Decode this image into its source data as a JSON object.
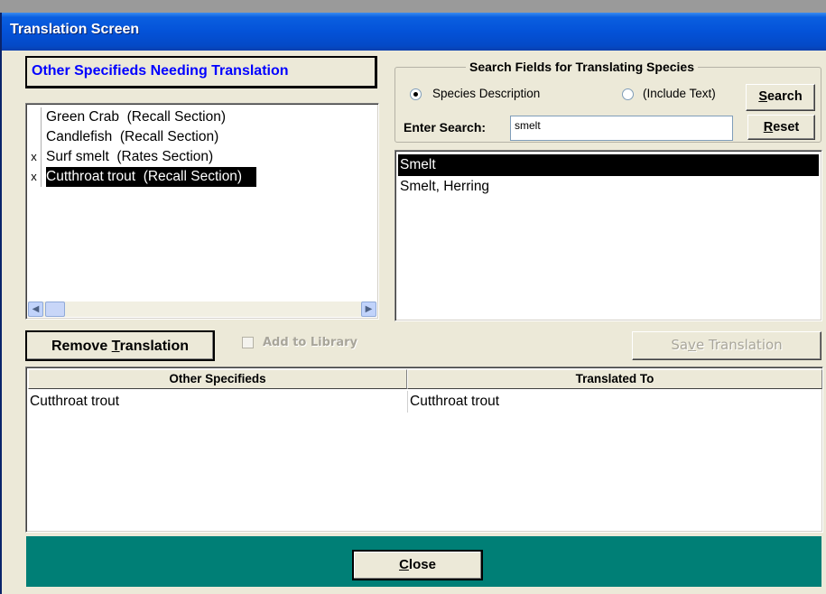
{
  "window": {
    "title": "Translation Screen",
    "titlebar_color": "#0452d8",
    "footer_color": "#007f76"
  },
  "left_panel": {
    "header": "Other Specifieds Needing Translation",
    "items": [
      {
        "mark": "",
        "label": "Green Crab  (Recall Section)",
        "selected": false
      },
      {
        "mark": "",
        "label": "Candlefish  (Recall Section)",
        "selected": false
      },
      {
        "mark": "x",
        "label": "Surf smelt  (Rates Section)",
        "selected": false
      },
      {
        "mark": "x",
        "label": "Cutthroat trout  (Recall Section)",
        "selected": true
      }
    ]
  },
  "search": {
    "group_title": "Search Fields for Translating Species",
    "radio_species": "Species Description",
    "radio_species_checked": true,
    "radio_include": "(Include Text)",
    "radio_include_checked": false,
    "enter_label": "Enter Search:",
    "value": "smelt",
    "search_button_prefix": "",
    "search_button_u": "S",
    "search_button_rest": "earch",
    "reset_button_u": "R",
    "reset_button_rest": "eset"
  },
  "results": {
    "items": [
      {
        "label": "Smelt",
        "selected": true
      },
      {
        "label": "Smelt, Herring",
        "selected": false
      }
    ]
  },
  "actions": {
    "remove_prefix": "Remove ",
    "remove_u": "T",
    "remove_rest": "ranslation",
    "add_to_library": "Add to Library",
    "add_to_library_checked": false,
    "save_prefix": "Sa",
    "save_u": "v",
    "save_rest": "e Translation"
  },
  "grid": {
    "columns": [
      "Other Specifieds",
      "Translated To"
    ],
    "rows": [
      [
        "Cutthroat trout",
        "Cutthroat trout"
      ]
    ]
  },
  "footer": {
    "close_u": "C",
    "close_rest": "lose"
  }
}
